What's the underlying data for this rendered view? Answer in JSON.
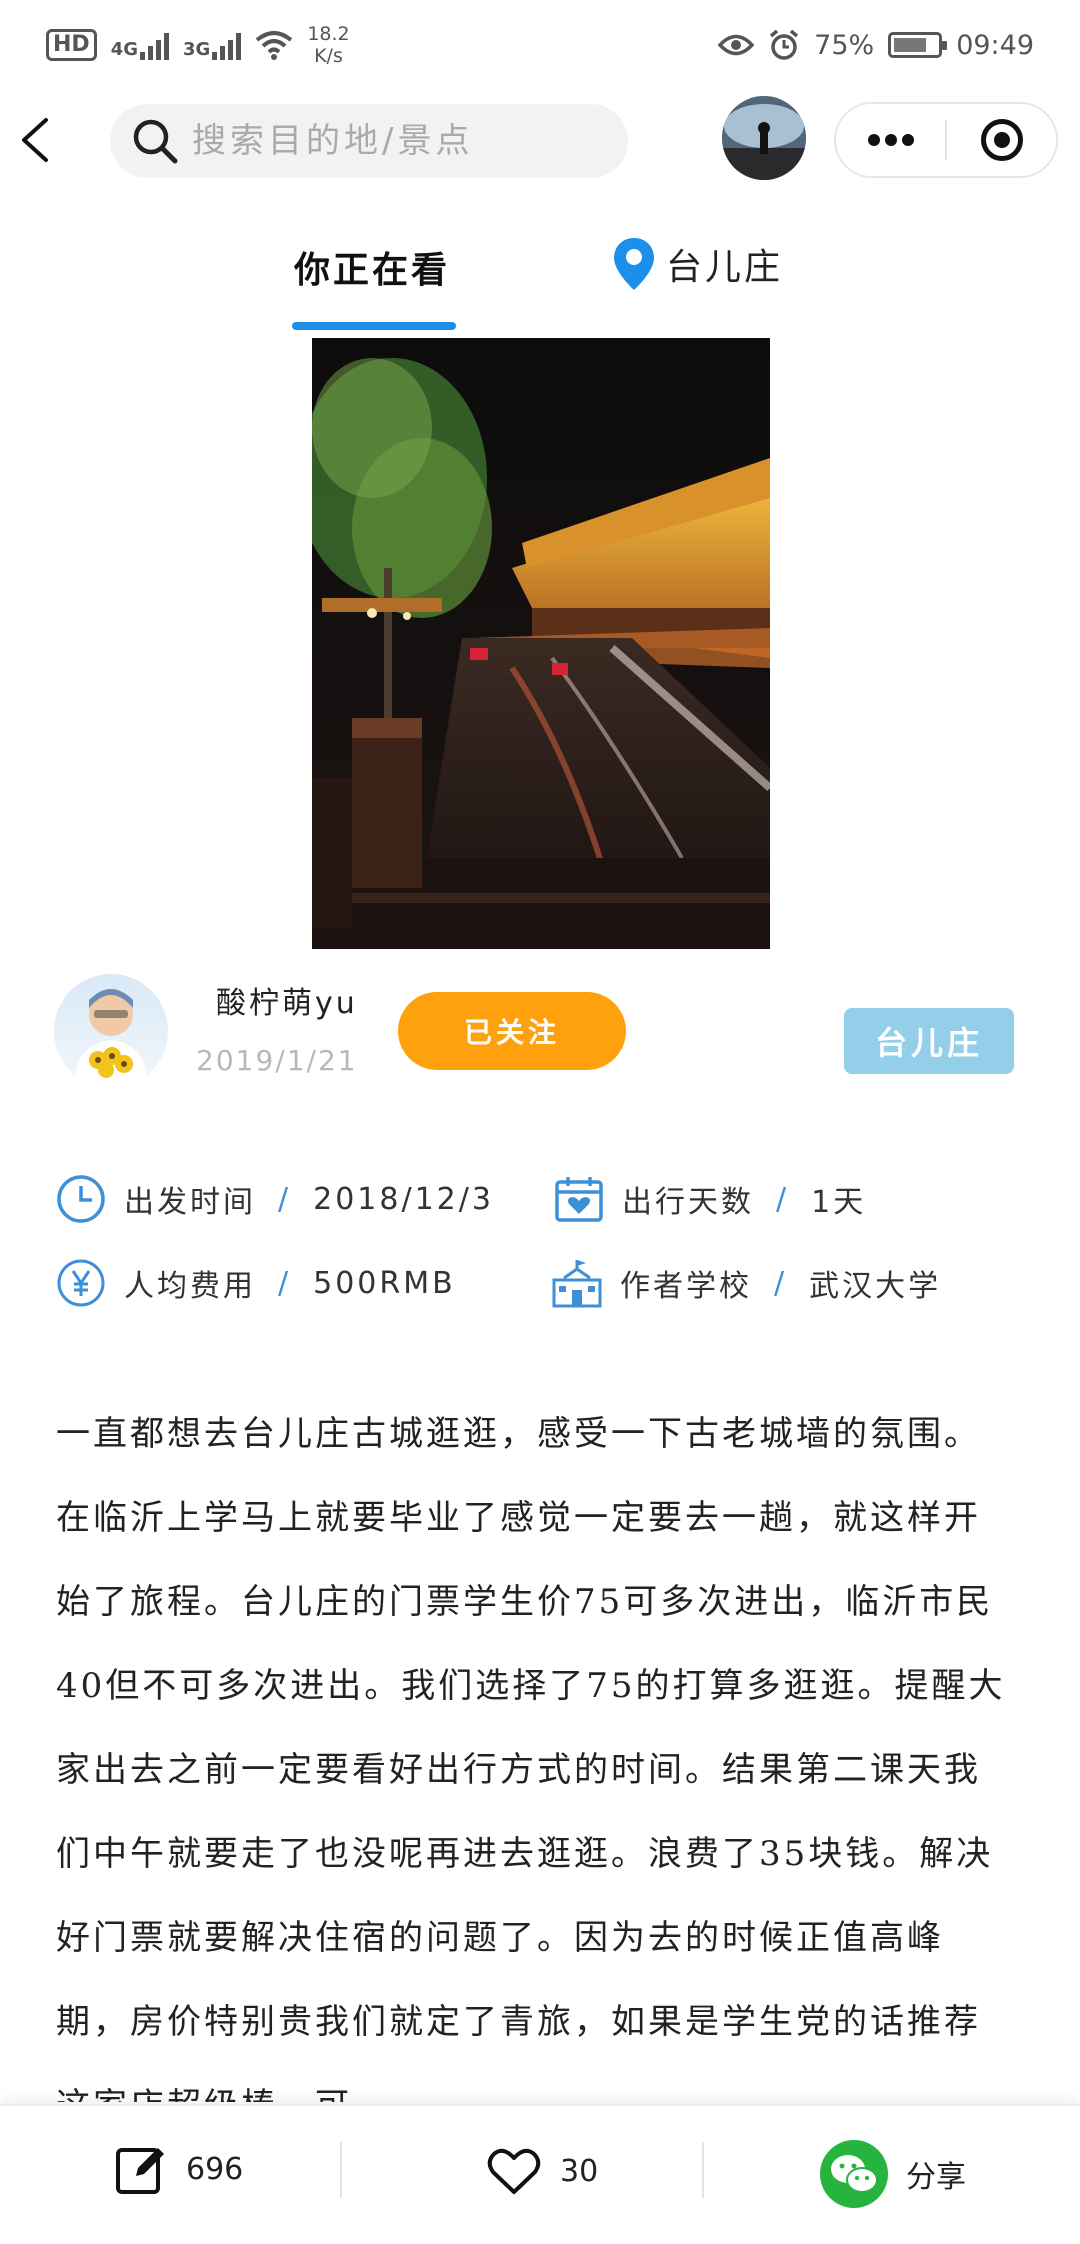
{
  "status_bar": {
    "hd": "HD",
    "net1": "4G",
    "net2": "3G",
    "speed_value": "18.2",
    "speed_unit": "K/s",
    "battery": "75%",
    "battery_level": 0.75,
    "time": "09:49"
  },
  "nav": {
    "search_placeholder": "搜索目的地/景点"
  },
  "tabs": {
    "watching": "你正在看",
    "location": "台儿庄"
  },
  "author": {
    "name": "酸柠萌yu",
    "date": "2019/1/21",
    "follow_label": "已关注",
    "tag_label": "台儿庄"
  },
  "info": {
    "depart_label": "出发时间",
    "depart_value": "2018/12/3",
    "days_label": "出行天数",
    "days_value": "1天",
    "cost_label": "人均费用",
    "cost_value": "500RMB",
    "school_label": "作者学校",
    "school_value": "武汉大学",
    "separator": "/"
  },
  "article": {
    "text": "一直都想去台儿庄古城逛逛，感受一下古老城墙的氛围。在临沂上学马上就要毕业了感觉一定要去一趟，就这样开始了旅程。台儿庄的门票学生价75可多次进出，临沂市民40但不可多次进出。我们选择了75的打算多逛逛。提醒大家出去之前一定要看好出行方式的时间。结果第二课天我们中午就要走了也没呢再进去逛逛。浪费了35块钱。解决好门票就要解决住宿的问题了。因为去的时候正值高峰期，房价特别贵我们就定了青旅，如果是学生党的话推荐这家店超级棒，可"
  },
  "bottom": {
    "comments": "696",
    "likes": "30",
    "share": "分享"
  },
  "colors": {
    "accent_blue": "#1e8fe8",
    "follow_orange": "#ffa10d",
    "tag_blue": "#94cfea",
    "wechat_green": "#26b43e"
  },
  "icons": [
    "back-arrow-icon",
    "search-icon",
    "more-dots-icon",
    "close-circle-icon",
    "location-pin-icon",
    "clock-icon",
    "calendar-heart-icon",
    "yen-icon",
    "school-icon",
    "edit-icon",
    "heart-icon",
    "wechat-icon"
  ]
}
